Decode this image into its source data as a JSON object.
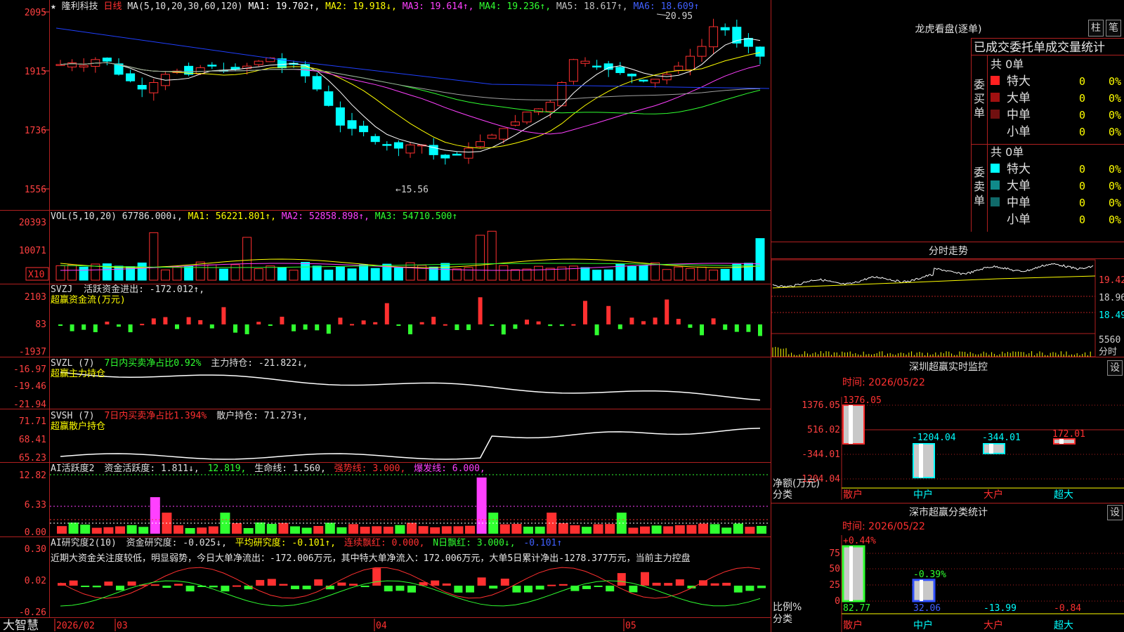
{
  "stock": {
    "star": "★",
    "name": "隆利科技",
    "period": "日线",
    "ma_label": "MA(5,10,20,30,60,120)",
    "ma1": "MA1: 19.702↑,",
    "ma2": "MA2: 19.918↓,",
    "ma3": "MA3: 19.614↑,",
    "ma4": "MA4: 19.236↑,",
    "ma5": "MA5: 18.617↑,",
    "ma6": "MA6: 18.609↑",
    "high_marker": "20.95",
    "low_marker": "←15.56"
  },
  "price_axis": [
    "2095",
    "1915",
    "1736",
    "1556"
  ],
  "vol": {
    "label": "VOL(5,10,20)",
    "value": "67786.000↓,",
    "ma1": "MA1: 56221.801↑,",
    "ma2": "MA2: 52858.898↑,",
    "ma3": "MA3: 54710.500↑",
    "axis": [
      "20393",
      "10071"
    ],
    "unit": "X10"
  },
  "svzj": {
    "label": "SVZJ",
    "subtitle": "活跃资金进出: -172.012↑,",
    "line2": "超赢资金流(万元)",
    "axis": [
      "2103",
      "83",
      "-1937"
    ]
  },
  "svzl": {
    "label": "SVZL (7)",
    "pct": "7日内买卖净占比0.92%",
    "hold": "主力持仓: -21.822↓,",
    "line2": "超赢主力持仓",
    "axis": [
      "-16.97",
      "-19.46",
      "-21.94"
    ]
  },
  "svsh": {
    "label": "SVSH (7)",
    "pct": "7日内买卖净占比1.394%",
    "hold": "散户持仓: 71.273↑,",
    "line2": "超赢散户持仓",
    "axis": [
      "71.71",
      "68.41",
      "65.23"
    ]
  },
  "ai1": {
    "label": "AI活跃度2",
    "a": "资金活跃度: 1.811↓,",
    "b": "12.819,",
    "c": "生命线: 1.560,",
    "d": "强势线: 3.000,",
    "e": "爆发线: 6.000,",
    "axis": [
      "12.82",
      "6.33",
      "0.00"
    ]
  },
  "ai2": {
    "label": "AI研究度2(10)",
    "a": "资金研究度: -0.025↓,",
    "b": "平均研究度: -0.101↑,",
    "c": "连续飘红: 0.000,",
    "d": "N日飘红: 3.000↓,",
    "e": "-0.101↑",
    "text": "近期大资金关注度较低，明显弱势，今日大单净流出：-172.006万元，其中特大单净流入：172.006万元，大单5日累计净出-1278.377万元，当前主力控盘",
    "axis": [
      "0.30",
      "0.02",
      "-0.26"
    ]
  },
  "time_axis": {
    "brand": "大智慧",
    "labels": [
      "2026/02",
      "03",
      "04",
      "05"
    ]
  },
  "right": {
    "lhb_title": "龙虎看盘(逐单)",
    "btn_bar": "柱",
    "btn_pen": "笔",
    "stats_title": "已成交委托单成交量统计",
    "buy": {
      "side_label": [
        "委",
        "买",
        "单"
      ],
      "total": "共 0单",
      "rows": [
        {
          "name": "特大",
          "count": "0",
          "pct": "0%",
          "color": "#ff2020"
        },
        {
          "name": "大单",
          "count": "0",
          "pct": "0%",
          "color": "#a01010"
        },
        {
          "name": "中单",
          "count": "0",
          "pct": "0%",
          "color": "#701010"
        },
        {
          "name": "小单",
          "count": "0",
          "pct": "0%",
          "color": ""
        }
      ]
    },
    "sell": {
      "side_label": [
        "委",
        "卖",
        "单"
      ],
      "total": "共 0单",
      "rows": [
        {
          "name": "特大",
          "count": "0",
          "pct": "0%",
          "color": "#00ffff"
        },
        {
          "name": "大单",
          "count": "0",
          "pct": "0%",
          "color": "#108a8a"
        },
        {
          "name": "中单",
          "count": "0",
          "pct": "0%",
          "color": "#106a6a"
        },
        {
          "name": "小单",
          "count": "0",
          "pct": "0%",
          "color": ""
        }
      ]
    },
    "minute": {
      "title": "分时走势",
      "axis": [
        "19.42",
        "18.96",
        "18.49",
        "5560"
      ],
      "unit": "分时"
    },
    "sz_monitor": {
      "title": "深圳超赢实时监控",
      "btn": "设",
      "time": "时间: 2026/05/22",
      "axis": [
        "1376.05",
        "516.02",
        "-344.01",
        "-1204.04"
      ],
      "ylabel1": "净额(万元)",
      "ylabel2": "分类",
      "bars": [
        {
          "cat": "散户",
          "value": 1376.05,
          "label": "1376.05",
          "color": "#ff3030"
        },
        {
          "cat": "中户",
          "value": -1204.04,
          "label": "-1204.04",
          "color": "#00ffff"
        },
        {
          "cat": "大户",
          "value": -344.01,
          "label": "-344.01",
          "color": "#00ffff"
        },
        {
          "cat": "超大",
          "value": 172.01,
          "label": "172.01",
          "color": "#ff3030"
        }
      ]
    },
    "sz_class": {
      "title": "深市超赢分类统计",
      "btn": "设",
      "time": "时间: 2026/05/22",
      "axis": [
        "75",
        "50",
        "25",
        "0"
      ],
      "ylabel1": "比例%",
      "ylabel2": "分类",
      "bars": [
        {
          "cat": "散户",
          "value": 82.77,
          "label": "82.77",
          "top": "+0.44%",
          "color": "#30ff30"
        },
        {
          "cat": "中户",
          "value": 32.06,
          "label": "32.06",
          "top": "-0.39%",
          "color": "#3050ff"
        },
        {
          "cat": "大户",
          "value": -13.99,
          "label": "-13.99",
          "top": "",
          "color": "#00ffff"
        },
        {
          "cat": "超大",
          "value": -0.84,
          "label": "-0.84",
          "top": "",
          "color": "#ff3030"
        }
      ]
    }
  },
  "colors": {
    "up": "#ff3030",
    "down": "#00ffff",
    "grid": "#b02020",
    "ma1": "#ffffff",
    "ma2": "#ffff00",
    "ma3": "#ff40ff",
    "ma4": "#30ff30",
    "ma5": "#a0a0a0",
    "ma6": "#2040ff"
  }
}
